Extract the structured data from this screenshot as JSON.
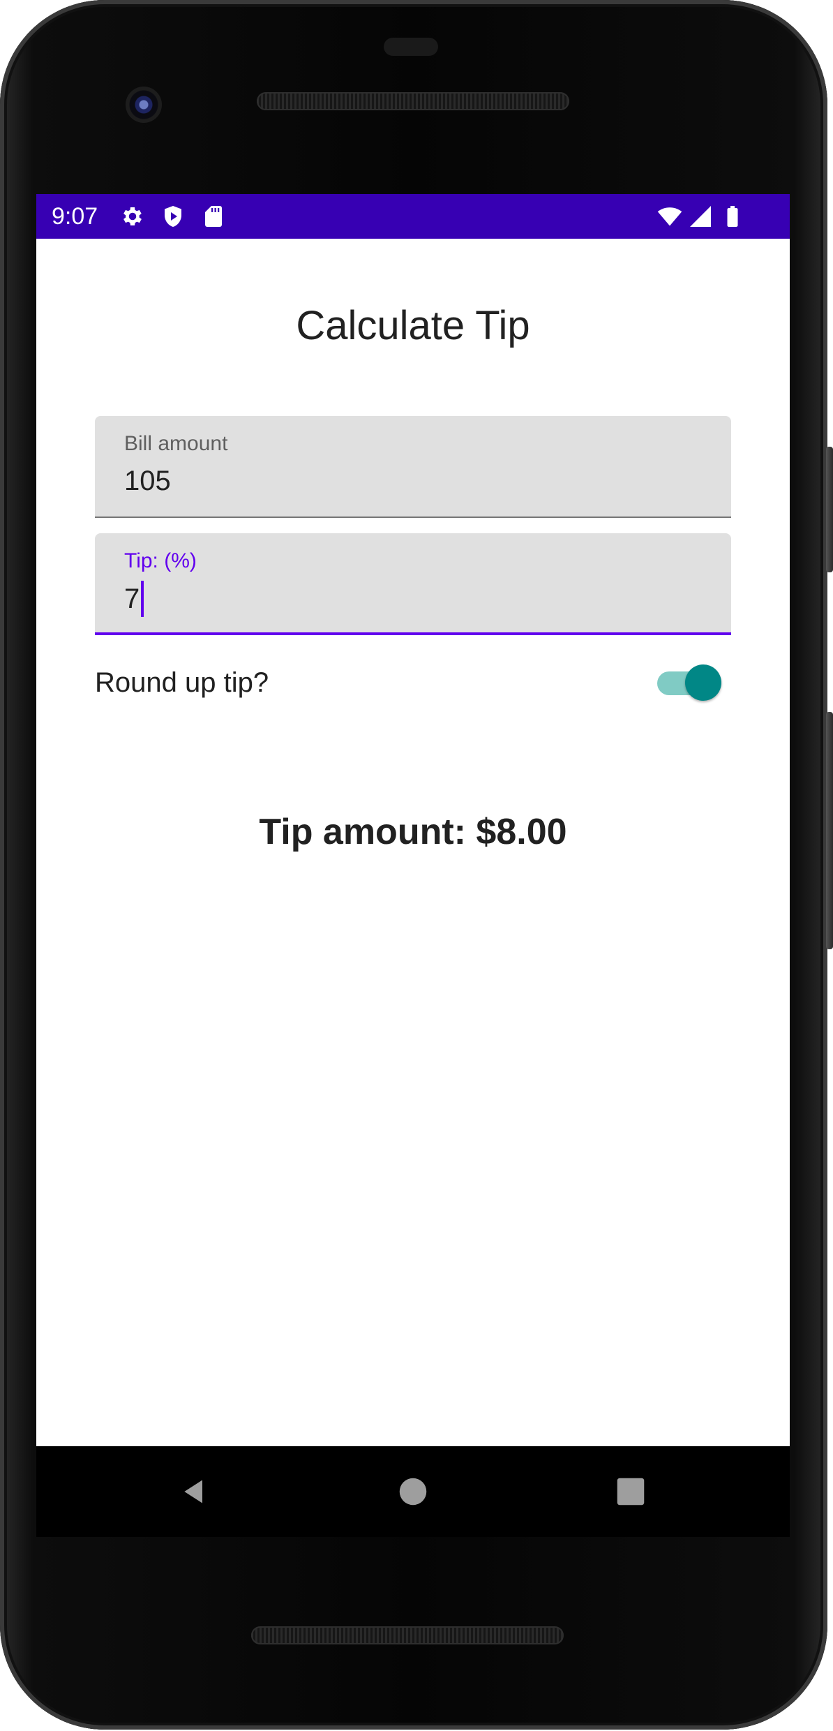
{
  "status_bar": {
    "time": "9:07",
    "background_color": "#3700b3",
    "left_icons": [
      "settings-icon",
      "shield-icon",
      "sd-card-icon"
    ],
    "right_icons": [
      "wifi-icon",
      "cell-signal-icon",
      "battery-icon"
    ]
  },
  "app": {
    "title": "Calculate Tip",
    "bill_field": {
      "label": "Bill amount",
      "value": "105"
    },
    "tip_field": {
      "label": "Tip: (%)",
      "value": "7",
      "focused": true,
      "accent_color": "#6200ee"
    },
    "round_up": {
      "label": "Round up tip?",
      "checked": true,
      "thumb_color": "#018786",
      "track_color": "#80cbc4"
    },
    "result_text": "Tip amount: $8.00"
  },
  "nav_bar": {
    "buttons": [
      "back-icon",
      "home-icon",
      "recents-icon"
    ]
  }
}
